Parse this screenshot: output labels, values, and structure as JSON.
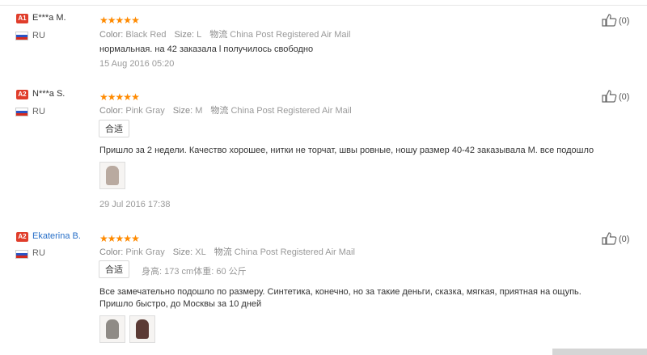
{
  "reviews": [
    {
      "level": "A1",
      "name": "E***a M.",
      "country": "RU",
      "rating": 5,
      "color_label": "Color:",
      "color": "Black Red",
      "size_label": "Size:",
      "size": "L",
      "shipping_label": "物流",
      "shipping": "China Post Registered Air Mail",
      "text": "нормальная. на 42 заказала l получилось свободно",
      "date": "15 Aug 2016 05:20",
      "helpful": "(0)"
    },
    {
      "level": "A2",
      "name": "N***a S.",
      "country": "RU",
      "rating": 5,
      "color_label": "Color:",
      "color": "Pink Gray",
      "size_label": "Size:",
      "size": "M",
      "shipping_label": "物流",
      "shipping": "China Post Registered Air Mail",
      "tag": "合适",
      "text": "Пришло за 2 недели. Качество хорошее, нитки не торчат, швы ровные, ношу размер 40-42 заказывала M. все подошло",
      "date": "29 Jul 2016 17:38",
      "helpful": "(0)"
    },
    {
      "level": "A2",
      "name": "Ekaterina B.",
      "country": "RU",
      "rating": 5,
      "color_label": "Color:",
      "color": "Pink Gray",
      "size_label": "Size:",
      "size": "XL",
      "shipping_label": "物流",
      "shipping": "China Post Registered Air Mail",
      "tag": "合适",
      "height_label": "身高:",
      "height": "173 cm",
      "weight_label": "体重:",
      "weight": "60 公斤",
      "text_line1": "Все замечательно подошло по размеру. Синтетика, конечно, но за такие деньги, сказка, мягкая, приятная на ощупь.",
      "text_line2": "Пришло быстро, до Москвы за 10 дней",
      "helpful": "(0)"
    }
  ],
  "colors": {
    "star": "#ff8a00",
    "level_badge": "#e03d2b",
    "link": "#2970c8"
  },
  "icons": [
    "thumbs-up-icon",
    "russia-flag-icon",
    "star-icon"
  ]
}
